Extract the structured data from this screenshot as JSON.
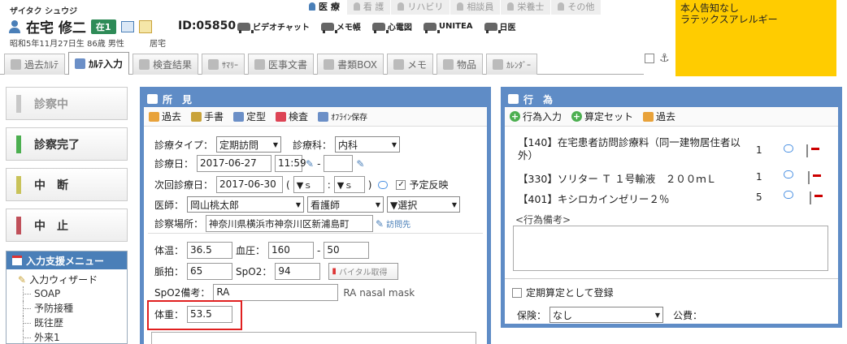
{
  "patient": {
    "kana": "ザイタク シュウジ",
    "name": "在宅 修二",
    "ward": "在1",
    "id": "ID:05850",
    "birth": "昭和5年11月27日生 86歳 男性",
    "location": "居宅"
  },
  "tools": [
    "ビデオチャット",
    "メモ帳",
    "心電図",
    "UNITEA",
    "日医"
  ],
  "roles": [
    "医 療",
    "看 護",
    "リハビリ",
    "相談員",
    "栄養士",
    "その他"
  ],
  "alert": [
    "本人告知なし",
    "ラテックスアレルギー"
  ],
  "tabs": [
    "過去ｶﾙﾃ",
    "ｶﾙﾃ入力",
    "検査結果",
    "ｻﾏﾘｰ",
    "医事文書",
    "書類BOX",
    "メモ",
    "物品",
    "ｶﾚﾝﾀﾞｰ"
  ],
  "status_buttons": [
    {
      "label": "診察中",
      "color": "#c8c8c8"
    },
    {
      "label": "診察完了",
      "color": "#4caf50"
    },
    {
      "label": "中　断",
      "color": "#c9c35a"
    },
    {
      "label": "中　止",
      "color": "#c0505a"
    }
  ],
  "assist": {
    "title": "入力支援メニュー",
    "root": "入力ウィザード",
    "items": [
      "SOAP",
      "予防接種",
      "既往歴",
      "外来1"
    ]
  },
  "findings": {
    "title": "所　見",
    "tools": [
      "過去",
      "手書",
      "定型",
      "検査",
      "ｵﾌﾗｲﾝ保存"
    ],
    "type_label": "診療タイプ：",
    "type_value": "定期訪問",
    "dept_label": "診療科：",
    "dept_value": "内科",
    "date_label": "診療日：",
    "date_value": "2017-06-27",
    "time_value": "11:59",
    "next_label": "次回診療日：",
    "next_value": "2017-06-30",
    "paren_open": "(",
    "colon": ":",
    "hour_sel": "▼ｓ",
    "min_sel": "▼ｓ",
    "paren_close": ")",
    "reflect": "予定反映",
    "doctor_label": "医師：",
    "doctor_value": "岡山桃太郎",
    "nurse_value": "看護師",
    "select_value": "▼選択",
    "place_label": "診察場所：",
    "place_value": "神奈川県横浜市神奈川区新浦島町",
    "visit_link": "訪問先",
    "temp_label": "体温：",
    "temp_value": "36.5",
    "bp_label": "血圧：",
    "bp_high": "160",
    "bp_low": "50",
    "pulse_label": "脈拍：",
    "pulse_value": "65",
    "spo2_label": "SpO2：",
    "spo2_value": "94",
    "vital_btn": "バイタル取得",
    "spo2note_label": "SpO2備考：",
    "spo2note_value": "RA",
    "spo2note_extra": "RA nasal mask",
    "weight_label": "体重：",
    "weight_value": "53.5",
    "dash": "-"
  },
  "actions": {
    "title": "行　為",
    "tools": [
      "行為入力",
      "算定セット",
      "過去"
    ],
    "rows": [
      {
        "text": "【140】在宅患者訪問診療料（同一建物居住者以外）",
        "qty": "1"
      },
      {
        "text": "【330】ソリター Ｔ １号輸液　２００ｍＬ",
        "qty": "1"
      },
      {
        "text": "【401】キシロカインゼリー２％",
        "qty": "5"
      }
    ],
    "memo_label": "<行為備考>",
    "periodic": "定期算定として登録",
    "insurance_label": "保険：",
    "insurance_value": "なし",
    "public_label": "公費："
  },
  "colors": {
    "panel": "#5f8cc6",
    "alert": "#ffcc00",
    "highlight": "#e02020"
  }
}
